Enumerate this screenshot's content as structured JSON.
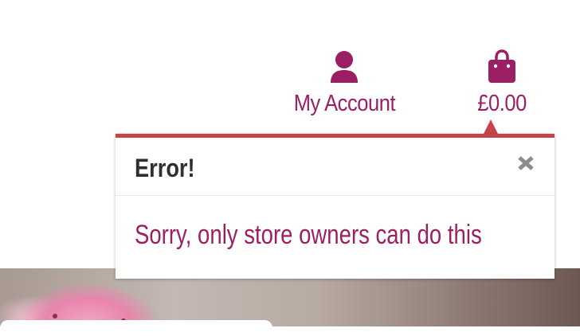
{
  "header": {
    "account_label": "My Account",
    "account_icon": "user-icon",
    "cart_label": "£0.00",
    "cart_icon": "shopping-bag-icon",
    "accent_color": "#9b1f63"
  },
  "popup": {
    "title": "Error!",
    "message": "Sorry, only store owners can do this",
    "close_icon": "close-icon",
    "border_color": "#c9434b"
  }
}
